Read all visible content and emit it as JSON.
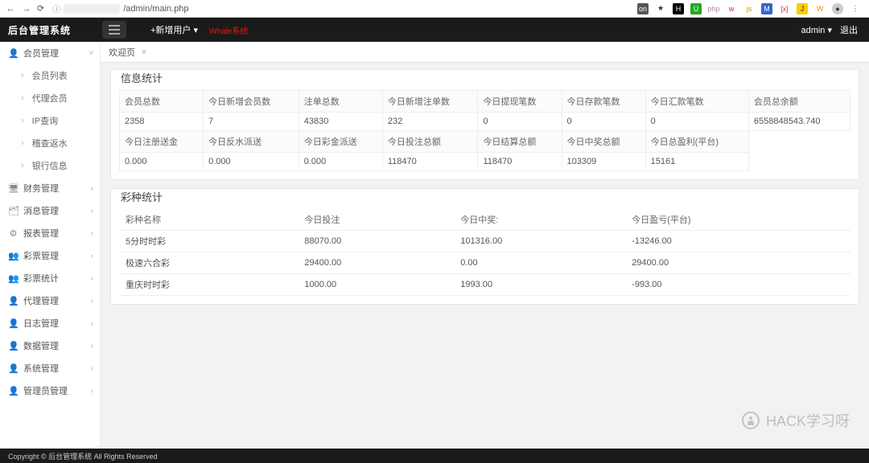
{
  "browser": {
    "url_path": "/admin/main.php",
    "ext_icons": [
      "on",
      "★",
      "H",
      "U",
      "php",
      "w",
      "js",
      "M",
      "[x]",
      "J",
      "W",
      "●"
    ]
  },
  "topbar": {
    "brand": "后台管理系统",
    "add_user": "+新增用户 ▾",
    "red_tag": "Whale系统",
    "admin_label": "admin ▾",
    "logout": "退出"
  },
  "sidebar": {
    "groups": [
      {
        "icon": "👤",
        "label": "会员管理",
        "open": true,
        "chev": "˅",
        "children": [
          "会员列表",
          "代理会员",
          "IP查询",
          "稽查返水",
          "银行信息"
        ]
      },
      {
        "icon": "🖥",
        "label": "财务管理",
        "chev": "‹"
      },
      {
        "icon": "🗂",
        "label": "消息管理",
        "chev": "‹"
      },
      {
        "icon": "⚙",
        "label": "报表管理",
        "chev": "‹"
      },
      {
        "icon": "👥",
        "label": "彩票管理",
        "chev": "‹"
      },
      {
        "icon": "👥",
        "label": "彩票统计",
        "chev": "‹"
      },
      {
        "icon": "👤",
        "label": "代理管理",
        "chev": "‹"
      },
      {
        "icon": "👤",
        "label": "日志管理",
        "chev": "‹"
      },
      {
        "icon": "👤",
        "label": "数据管理",
        "chev": "‹"
      },
      {
        "icon": "👤",
        "label": "系统管理",
        "chev": "‹"
      },
      {
        "icon": "👤",
        "label": "管理员管理",
        "chev": "‹"
      }
    ]
  },
  "tabs": {
    "welcome": "欢迎页"
  },
  "stats": {
    "title": "信息统计",
    "row1_heads": [
      "会员总数",
      "今日新增会员数",
      "注单总数",
      "今日新增注单数",
      "今日提现笔数",
      "今日存款笔数",
      "今日汇款笔数",
      "会员总余额"
    ],
    "row1_vals": [
      "2358",
      "7",
      "43830",
      "232",
      "0",
      "0",
      "0",
      "6558848543.740"
    ],
    "row2_heads": [
      "今日注册送金",
      "今日反水派送",
      "今日彩金派送",
      "今日投注总额",
      "今日结算总额",
      "今日中奖总额",
      "今日总盈利(平台)"
    ],
    "row2_vals": [
      "0.000",
      "0.000",
      "0.000",
      "118470",
      "118470",
      "103309",
      "15161"
    ]
  },
  "lottery": {
    "title": "彩种统计",
    "heads": [
      "彩种名称",
      "今日投注",
      "今日中奖:",
      "今日盈亏(平台)"
    ],
    "rows": [
      [
        "5分时时彩",
        "88070.00",
        "101316.00",
        "-13246.00"
      ],
      [
        "极速六合彩",
        "29400.00",
        "0.00",
        "29400.00"
      ],
      [
        "重庆时时彩",
        "1000.00",
        "1993.00",
        "-993.00"
      ]
    ]
  },
  "footer": "Copyright © 后台管理系统 All Rights Reserved",
  "watermark": "HACK学习呀"
}
